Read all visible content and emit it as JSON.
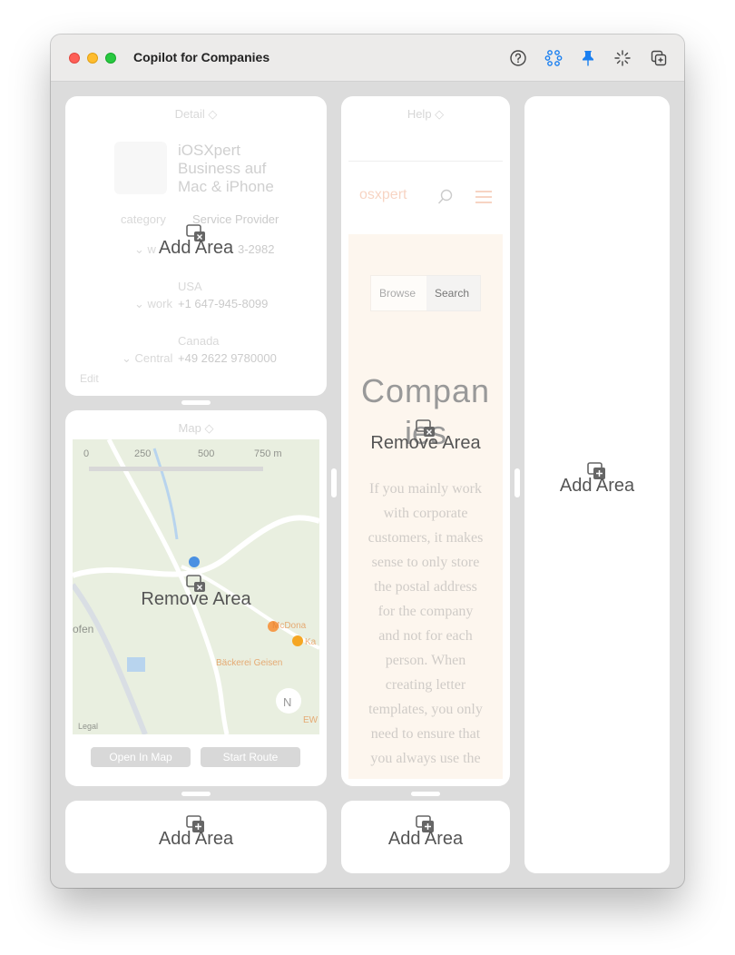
{
  "window": {
    "title": "Copilot for Companies"
  },
  "toolbar": {
    "icons": [
      "help-icon",
      "network-icon",
      "pin-icon",
      "sparkle-icon",
      "new-window-icon"
    ],
    "accent": "#1a7ff0"
  },
  "detail_panel": {
    "header": "Detail ◇",
    "company": "iOSXpert Business auf Mac & iPhone",
    "name_line1": "iOSXpert",
    "name_line2": "Business auf",
    "name_line3": "Mac & iPhone",
    "category_label": "category",
    "category_value": "Service Provider",
    "row1_label": "⌄ w",
    "row1_value": "3-2982",
    "usa": "USA",
    "row2_label": "⌄ work",
    "row2_value": "+1 647-945-8099",
    "canada": "Canada",
    "row3_label": "⌄ Central",
    "row3_value": "+49 2622 9780000",
    "edit": "Edit",
    "overlay": "Add Area"
  },
  "map_panel": {
    "header": "Map ◇",
    "scale": [
      "0",
      "250",
      "500",
      "750 m"
    ],
    "labels": [
      "McDona",
      "Ka",
      "Bäckerei Geisen",
      "ofen",
      "Legal",
      "N",
      "EW"
    ],
    "open_in_map": "Open In Map",
    "start_route": "Start Route",
    "overlay": "Remove Area"
  },
  "help_panel": {
    "header": "Help ◇",
    "logo": "osxpert",
    "browse_placeholder": "Browse",
    "search_button": "Search",
    "heading": "Compan",
    "heading2": "ies",
    "body_lines": [
      "If you mainly work",
      "with corporate",
      "customers, it makes",
      "sense to only store",
      "the postal address",
      "for the company",
      "and not for each",
      "person. When",
      "creating letter",
      "templates, you only",
      "need to ensure that",
      "you always use the"
    ],
    "overlay": "Remove Area"
  },
  "right_panel": {
    "overlay": "Add Area"
  },
  "bottom_left_panel": {
    "overlay": "Add Area"
  },
  "bottom_mid_panel": {
    "overlay": "Add Area"
  }
}
